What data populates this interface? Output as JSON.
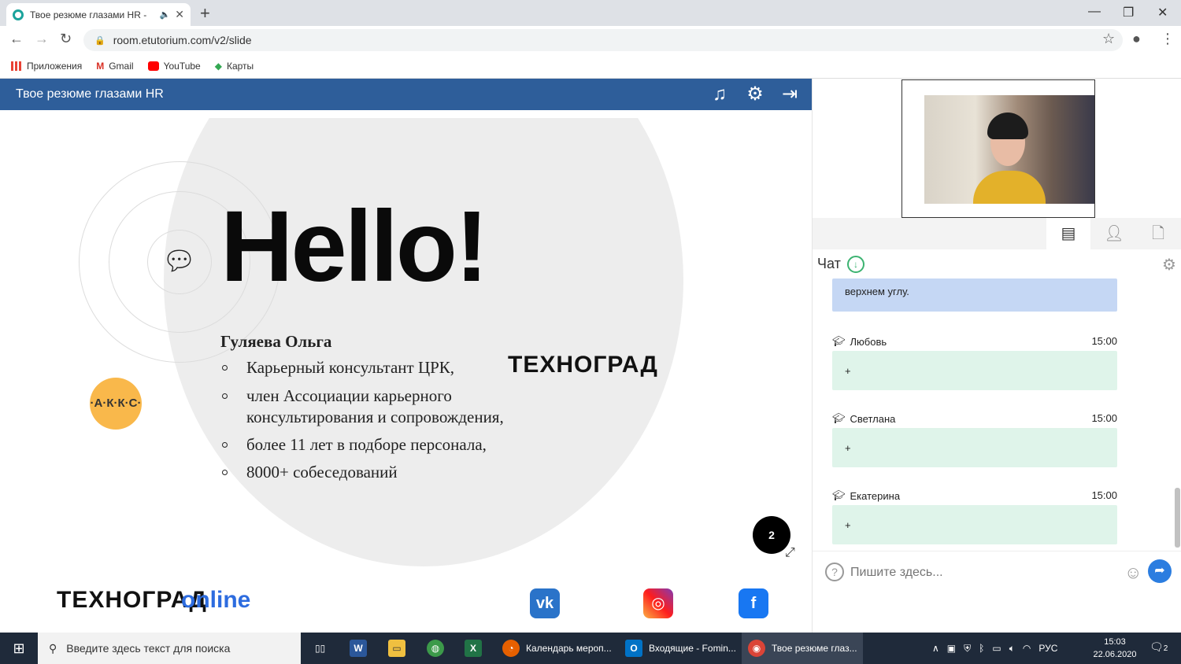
{
  "browser": {
    "tab_title": "Твое резюме глазами HR -",
    "url": "room.etutorium.com/v2/slide",
    "bookmarks": [
      "Приложения",
      "Gmail",
      "YouTube",
      "Карты"
    ]
  },
  "app": {
    "header_title": "Твое резюме глазами HR"
  },
  "slide": {
    "hello": "Hello!",
    "speaker": "Гуляева Ольга",
    "bullets": [
      "Карьерный консультант ЦРК,",
      "член Ассоциации карьерного",
      "консультирования и сопровождения,",
      "более 11 лет в подборе персонала,",
      "8000+ собеседований"
    ],
    "akks_logo": "·А·К·К·С·",
    "tehnograd_logo": "ТЕХНОГРАД",
    "tehnograd_online_a": "ТЕХНОГРАД",
    "tehnograd_online_b": "online",
    "page_number": "2"
  },
  "chat": {
    "title": "Чат",
    "first_message_tail": "верхнем углу.",
    "messages": [
      {
        "author": "Любовь",
        "time": "15:00",
        "text": "+"
      },
      {
        "author": "Светлана",
        "time": "15:00",
        "text": "+"
      },
      {
        "author": "Екатерина",
        "time": "15:00",
        "text": "+"
      }
    ],
    "input_placeholder": "Пишите здесь..."
  },
  "taskbar": {
    "search_placeholder": "Введите здесь текст для поиска",
    "items": [
      "Календарь мероп...",
      "Входящие - Fomin...",
      "Твое резюме глаз..."
    ],
    "lang": "РУС",
    "time": "15:03",
    "date": "22.06.2020",
    "notifications": "2"
  },
  "colors": {
    "header_blue": "#2e5e9a",
    "bubble_green": "#dff4ea",
    "bubble_blue": "#c5d7f4",
    "akks_orange": "#f9b84b",
    "online_blue": "#2d6cdf"
  }
}
